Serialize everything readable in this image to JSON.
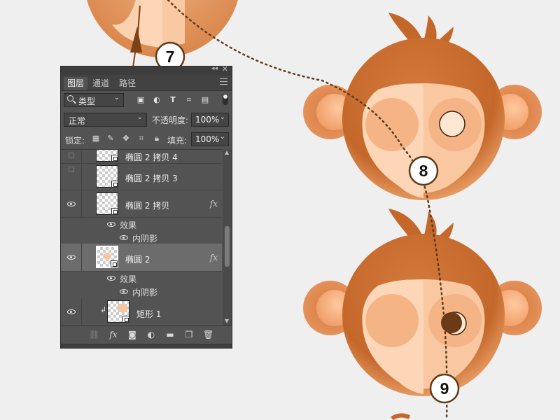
{
  "steps": [
    "7",
    "8",
    "9"
  ],
  "colors": {
    "hair": "#c4672a",
    "face_light": "#fcd0ac",
    "face_mid": "#f4b486",
    "eye_dark": "#6b3a17",
    "guide_line": "#5e3b1a",
    "arrow": "#7c4216"
  },
  "panel": {
    "tabs": [
      "图层",
      "通道",
      "路径"
    ],
    "kind_filter": "类型",
    "blend_mode": "正常",
    "opacity_label": "不透明度:",
    "opacity_value": "100%",
    "lock_label": "锁定:",
    "fill_label": "填充:",
    "fill_value": "100%",
    "layers": [
      {
        "name": "椭圆 2 拷贝 4",
        "visible": false
      },
      {
        "name": "椭圆 2 拷贝 3",
        "visible": false
      },
      {
        "name": "椭圆 2 拷贝",
        "visible": true,
        "fx": "fx",
        "effects_label": "效果",
        "effect": "内阴影"
      },
      {
        "name": "椭圆 2",
        "visible": true,
        "selected": true,
        "fx": "fx",
        "effects_label": "效果",
        "effect": "内阴影"
      },
      {
        "name": "矩形 1",
        "visible": true,
        "clipped": true
      }
    ],
    "icons": {
      "filter_icons": [
        "image-filter-icon",
        "adjustment-filter-icon",
        "type-filter-icon",
        "shape-filter-icon",
        "smart-object-filter-icon"
      ],
      "lock_icons": [
        "lock-transparent-icon",
        "lock-image-icon",
        "lock-position-icon",
        "lock-artboard-icon",
        "lock-all-icon"
      ],
      "bottom_icons": [
        "link-layers-icon",
        "fx-icon",
        "mask-icon",
        "adjustment-layer-icon",
        "new-group-icon",
        "new-layer-icon",
        "delete-layer-icon"
      ]
    }
  }
}
